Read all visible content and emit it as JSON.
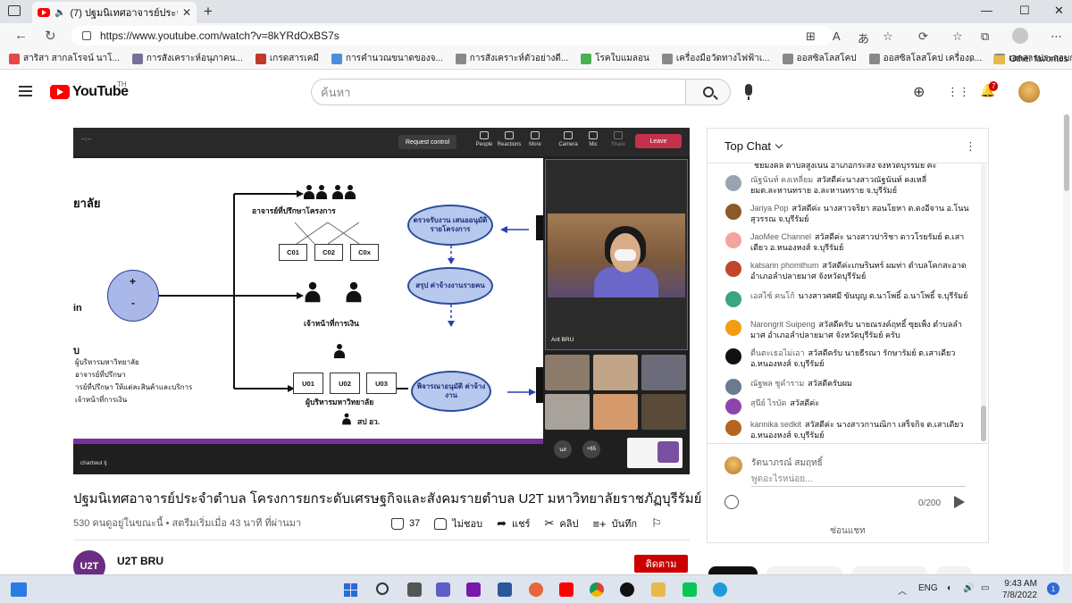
{
  "browser": {
    "tab_title": "(7) ปฐมนิเทศอาจารย์ประจำตำบล",
    "tab_close": "✕",
    "new_tab": "+",
    "window_controls": [
      "—",
      "☐",
      "✕"
    ],
    "url": "https://www.youtube.com/watch?v=8kYRdOxBS7s",
    "nav": {
      "back": "←",
      "reload": "↻"
    },
    "address_icons": [
      "⊞",
      "A",
      "あ",
      "☆",
      "⟳",
      "☆",
      "⧉"
    ],
    "bookmarks": [
      {
        "label": "สาริสา สากลโรจน์ นาโ...",
        "color": "#e54646"
      },
      {
        "label": "การสังเคราะห์อนุภาคน...",
        "color": "#7a6f9b"
      },
      {
        "label": "เกรดสารเคมี",
        "color": "#c0392b"
      },
      {
        "label": "การคำนวณขนาดของจ...",
        "color": "#4a90d9"
      },
      {
        "label": "การสังเคราะห์ตัวอย่างดี...",
        "color": "#888888"
      },
      {
        "label": "โรคใบแมลอน",
        "color": "#4caf50"
      },
      {
        "label": "เครื่องมือวัดทางไฟฟ้าเ...",
        "color": "#888888"
      },
      {
        "label": "ออสซิลโลสโคป",
        "color": "#888888"
      },
      {
        "label": "ออสซิลโลสโคป เครื่องก...",
        "color": "#888888"
      },
      {
        "label": "เอกสารประกอบการสอนเ...",
        "color": "#888888"
      }
    ],
    "bookmarks_more": "›",
    "other_favorites": "Other favorites"
  },
  "youtube": {
    "logo_text": "YouTube",
    "country": "TH",
    "search_placeholder": "ค้นหา",
    "notification_count": "7",
    "header_icons": {
      "create": "⊕",
      "apps": "⋮⋮",
      "bell": "🔔"
    }
  },
  "player": {
    "teams": {
      "timer": "--:--",
      "request_control": "Request control",
      "people": "People",
      "reactions": "Reactions",
      "more": "More",
      "camera": "Camera",
      "mic": "Mic",
      "share": "Share",
      "leave": "Leave",
      "presenter_name": "Arit BRU",
      "participants_extra": "+65",
      "participant_initials": "นส",
      "caption": "chartwut tj"
    },
    "slide": {
      "title_top": "อาจารย์ที่ปรึกษาโครงการ",
      "co_boxes": [
        "C01",
        "C02",
        "C0x"
      ],
      "finance_staff": "เจ้าหน้าที่การเงิน",
      "u_boxes": [
        "U01",
        "U02",
        "U03"
      ],
      "uni_admin": "ผู้บริหารมหาวิทยาลัย",
      "spo": "สป อว.",
      "left_title": "ยาลัย",
      "left_in": "in",
      "left_u": "บ",
      "left_list": [
        "ผู้บริหารมหาวิทยาลัย",
        "อาจารย์ที่ปรึกษา",
        "ารย์ที่ปรึกษา ให้แต่ละสินค้าและบริการ",
        "เจ้าหน้าที่การเงิน"
      ],
      "plus": "+",
      "minus": "-",
      "oval_review": "ตรวจรับงาน เสนออนุมัติ รายโครงการ",
      "oval_summary": "สรุป ค่าจ้างงานรายคน",
      "oval_approve": "พิจารณาอนุมัติ ค่าจ้างงาน"
    }
  },
  "video": {
    "title": "ปฐมนิเทศอาจารย์ประจำตำบล โครงการยกระดับเศรษฐกิจและสังคมรายตำบล U2T มหาวิทยาลัยราชภัฏบุรีรัมย์",
    "meta": "530 คนดูอยู่ในขณะนี้ • สตรีมเริ่มเมื่อ 43 นาที ที่ผ่านมา",
    "likes": "37",
    "dislike": "ไม่ชอบ",
    "share": "แชร์",
    "clip": "คลิป",
    "save": "บันทึก",
    "channel": "U2T BRU",
    "channel_initials": "U2T",
    "subscribe": "ติดตาม"
  },
  "chat": {
    "title": "Top Chat",
    "more": "⋮",
    "messages": [
      {
        "author": "",
        "text": "ชยมงคล ตำบลสูงเนิน อำเภอกระสัง จังหวัดบุรีรัมย์ ค่ะ",
        "color": "#ffffff"
      },
      {
        "author": "ณัฐนันท์ คงเหลี่ยม",
        "text": "สวัสดีค่ะนางสาวณัฐนันท์ คงเหลี่ยมต.ละหานทราย อ.ละหานทราย จ.บุรีรัมย์",
        "color": "#9aa4b1"
      },
      {
        "author": "Jariya Pop",
        "text": "สวัสดีค่ะ นางสาวจริยา สอนโยหา ต.ดงอีจาน อ.โนนสุวรรณ จ.บุรีรัมย์",
        "color": "#8a5a2b"
      },
      {
        "author": "JaoMee Channel",
        "text": "สวัสดีค่ะ นางสาวปาริชา ดาวโรยรัมย์ ต.เสาเดียว อ.หนองหงส์ จ.บุรีรัมย์",
        "color": "#f3a49c"
      },
      {
        "author": "katsarin phomthum",
        "text": "สวัสดีค่ะเกษรินทร์ ผมท่า ตำบลโคกสะอาด อำเภอลำปลายมาศ จังหวัดบุรีรัมย์",
        "color": "#c0462a"
      },
      {
        "author": "เอสไซ์ คนโก้",
        "text": "นางสาวศศมี ขันบุญ ต.นาโพธิ์ อ.นาโพธิ์ จ.บุรีรัมย์",
        "color": "#3aa57e"
      },
      {
        "author": "Narongrit Suipeng",
        "text": "สวัสดีครับ นายณรงค์ฤทธิ์ ซุยเพ็ง ตำบลลำมาศ อำเภอลำปลายมาศ จังหวัดบุรีรัมย์ ครับ",
        "color": "#f39c12"
      },
      {
        "author": "ตื่นตะเธอไม่เอา",
        "text": "สวัสดีครับ นายธีรณา รักษารัมย์ ต.เสาเดียว อ.หนองหงส์ จ.บุรีรัมย์",
        "color": "#111111"
      },
      {
        "author": "ณัฐพล ชูคำราม",
        "text": "สวัสดีครับผม",
        "color": "#6b7a8f"
      },
      {
        "author": "สุนีย์ ไรบัด",
        "text": "สวัสดีค่ะ",
        "color": "#8e44ad"
      },
      {
        "author": "kannika sedkit",
        "text": "สวัสดีค่ะ นางสาวกานณิกา เสร็จกิจ ต.เสาเดียว อ.หนองหงส์ จ.บุรีรัมย์",
        "color": "#b5651d"
      }
    ],
    "me_name": "รัตนาภรณ์ สมฤทธิ์",
    "input_placeholder": "พูดอะไรหน่อย...",
    "counter": "0/200",
    "hide": "ซ่อนแชท"
  },
  "taskbar": {
    "lang": "ENG",
    "time": "9:43 AM",
    "date": "7/8/2022",
    "notifications": "1",
    "tray_up": "︿",
    "tray_icons": [
      "◐",
      "🔊",
      "▭"
    ]
  }
}
